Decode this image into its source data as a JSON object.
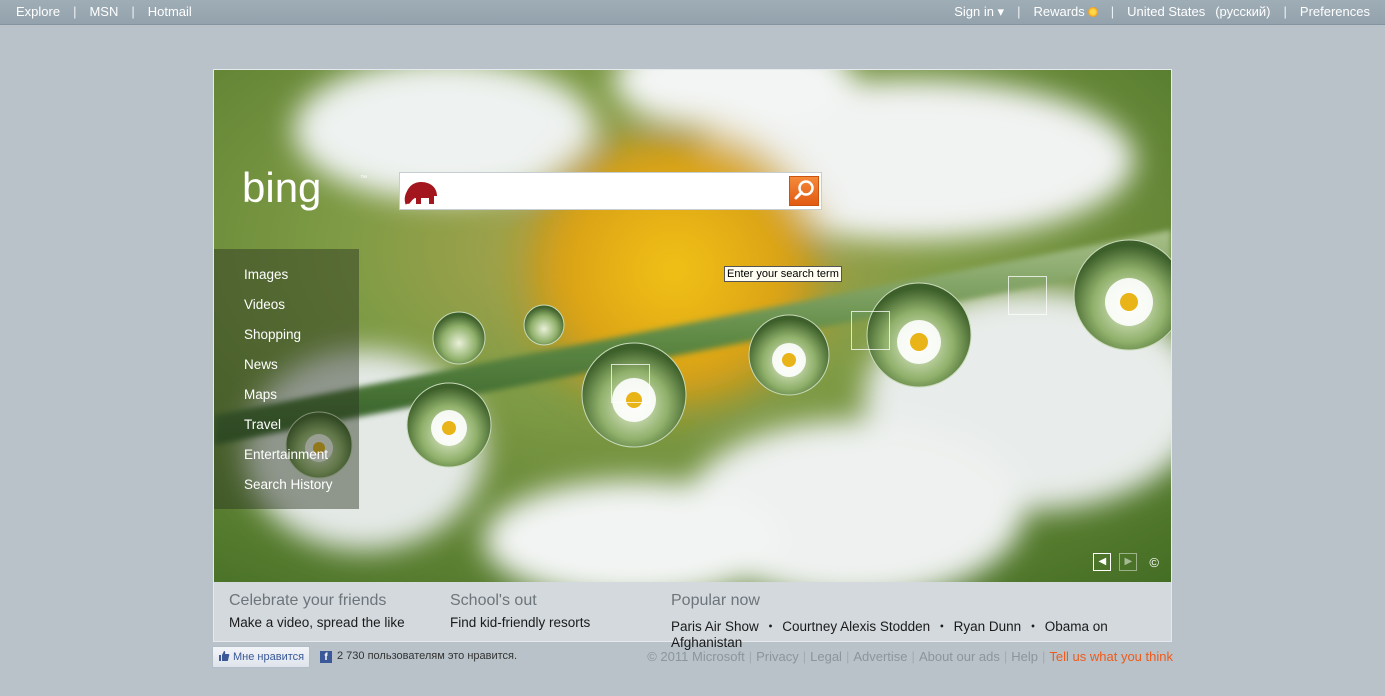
{
  "topbar": {
    "left": [
      "Explore",
      "MSN",
      "Hotmail"
    ],
    "sign_in": "Sign in ▾",
    "rewards": "Rewards",
    "region": "United States",
    "language": "(русский)",
    "preferences": "Preferences"
  },
  "search": {
    "value": "",
    "tooltip": "Enter your search term"
  },
  "nav": [
    "Images",
    "Videos",
    "Shopping",
    "News",
    "Maps",
    "Travel",
    "Entertainment",
    "Search History"
  ],
  "hero": {
    "prev": "◀",
    "next": "▶",
    "copyright": "©"
  },
  "promos": [
    {
      "title": "Celebrate your friends",
      "sub": "Make a video, spread the like"
    },
    {
      "title": "School's out",
      "sub": "Find kid-friendly resorts"
    }
  ],
  "popular": {
    "title": "Popular now",
    "items": [
      "Paris Air Show",
      "Courtney Alexis Stodden",
      "Ryan Dunn",
      "Obama on Afghanistan"
    ],
    "separator": "・"
  },
  "facebook": {
    "like": "Мне нравится",
    "count": "2 730 пользователям это нравится."
  },
  "footer": {
    "links": [
      "© 2011 Microsoft",
      "Privacy",
      "Legal",
      "Advertise",
      "About our ads",
      "Help"
    ],
    "feedback": "Tell us what you think"
  },
  "colors": {
    "accent": "#f05a1a",
    "page_bg": "#b8c2c8",
    "fb_blue": "#3b5998"
  }
}
